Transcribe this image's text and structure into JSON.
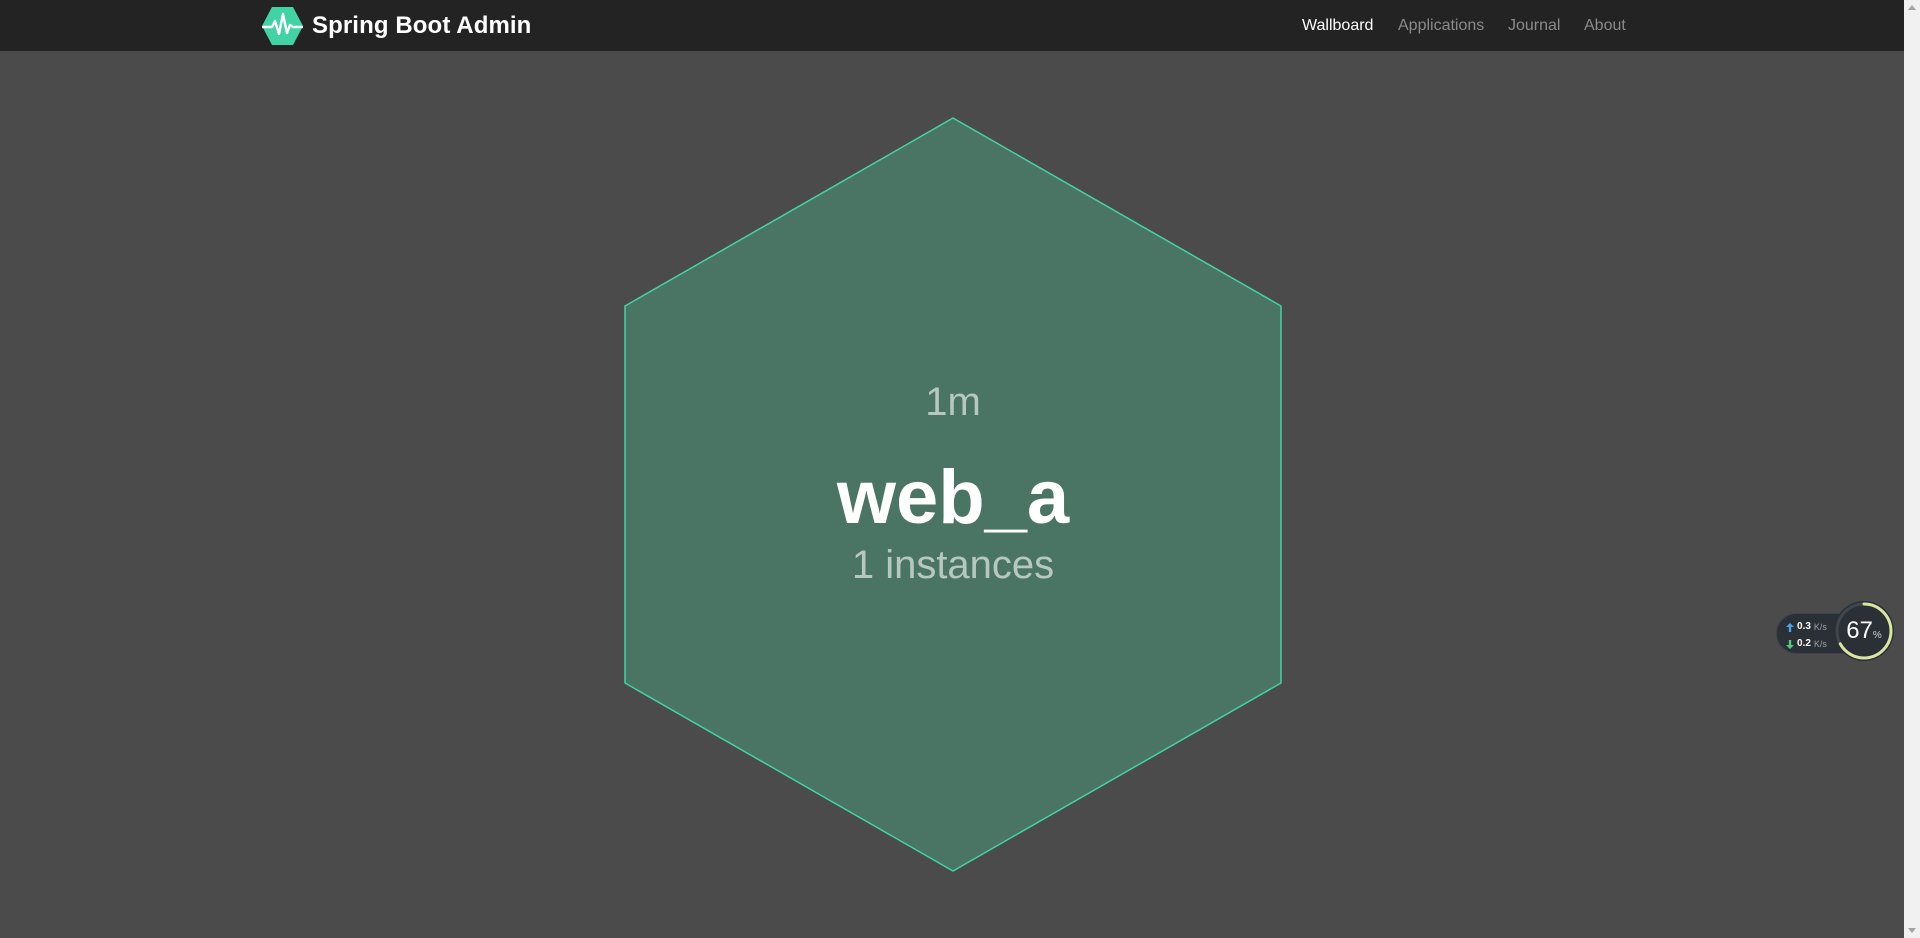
{
  "header": {
    "brand": {
      "title": "Spring Boot Admin",
      "logo_icon": "heartbeat-hexagon-icon"
    },
    "nav": [
      {
        "label": "Wallboard",
        "active": true
      },
      {
        "label": "Applications",
        "active": false
      },
      {
        "label": "Journal",
        "active": false
      },
      {
        "label": "About",
        "active": false
      }
    ]
  },
  "wallboard": {
    "applications": [
      {
        "name": "web_a",
        "uptime": "1m",
        "instances": "1 instances",
        "status_color": "#42d3a5",
        "fill_color": "#4a7564"
      }
    ]
  },
  "network_widget": {
    "upload": {
      "value": "0.3",
      "unit": "K/s",
      "icon": "arrow-up-icon"
    },
    "download": {
      "value": "0.2",
      "unit": "K/s",
      "icon": "arrow-down-icon"
    },
    "usage": {
      "value": "67",
      "unit": "%",
      "fraction": 0.67
    }
  },
  "colors": {
    "navbar_bg": "#232323",
    "page_bg": "#4b4b4b",
    "accent": "#42d3a5",
    "nav_inactive": "#8a8a8a",
    "nav_active": "#ffffff"
  }
}
